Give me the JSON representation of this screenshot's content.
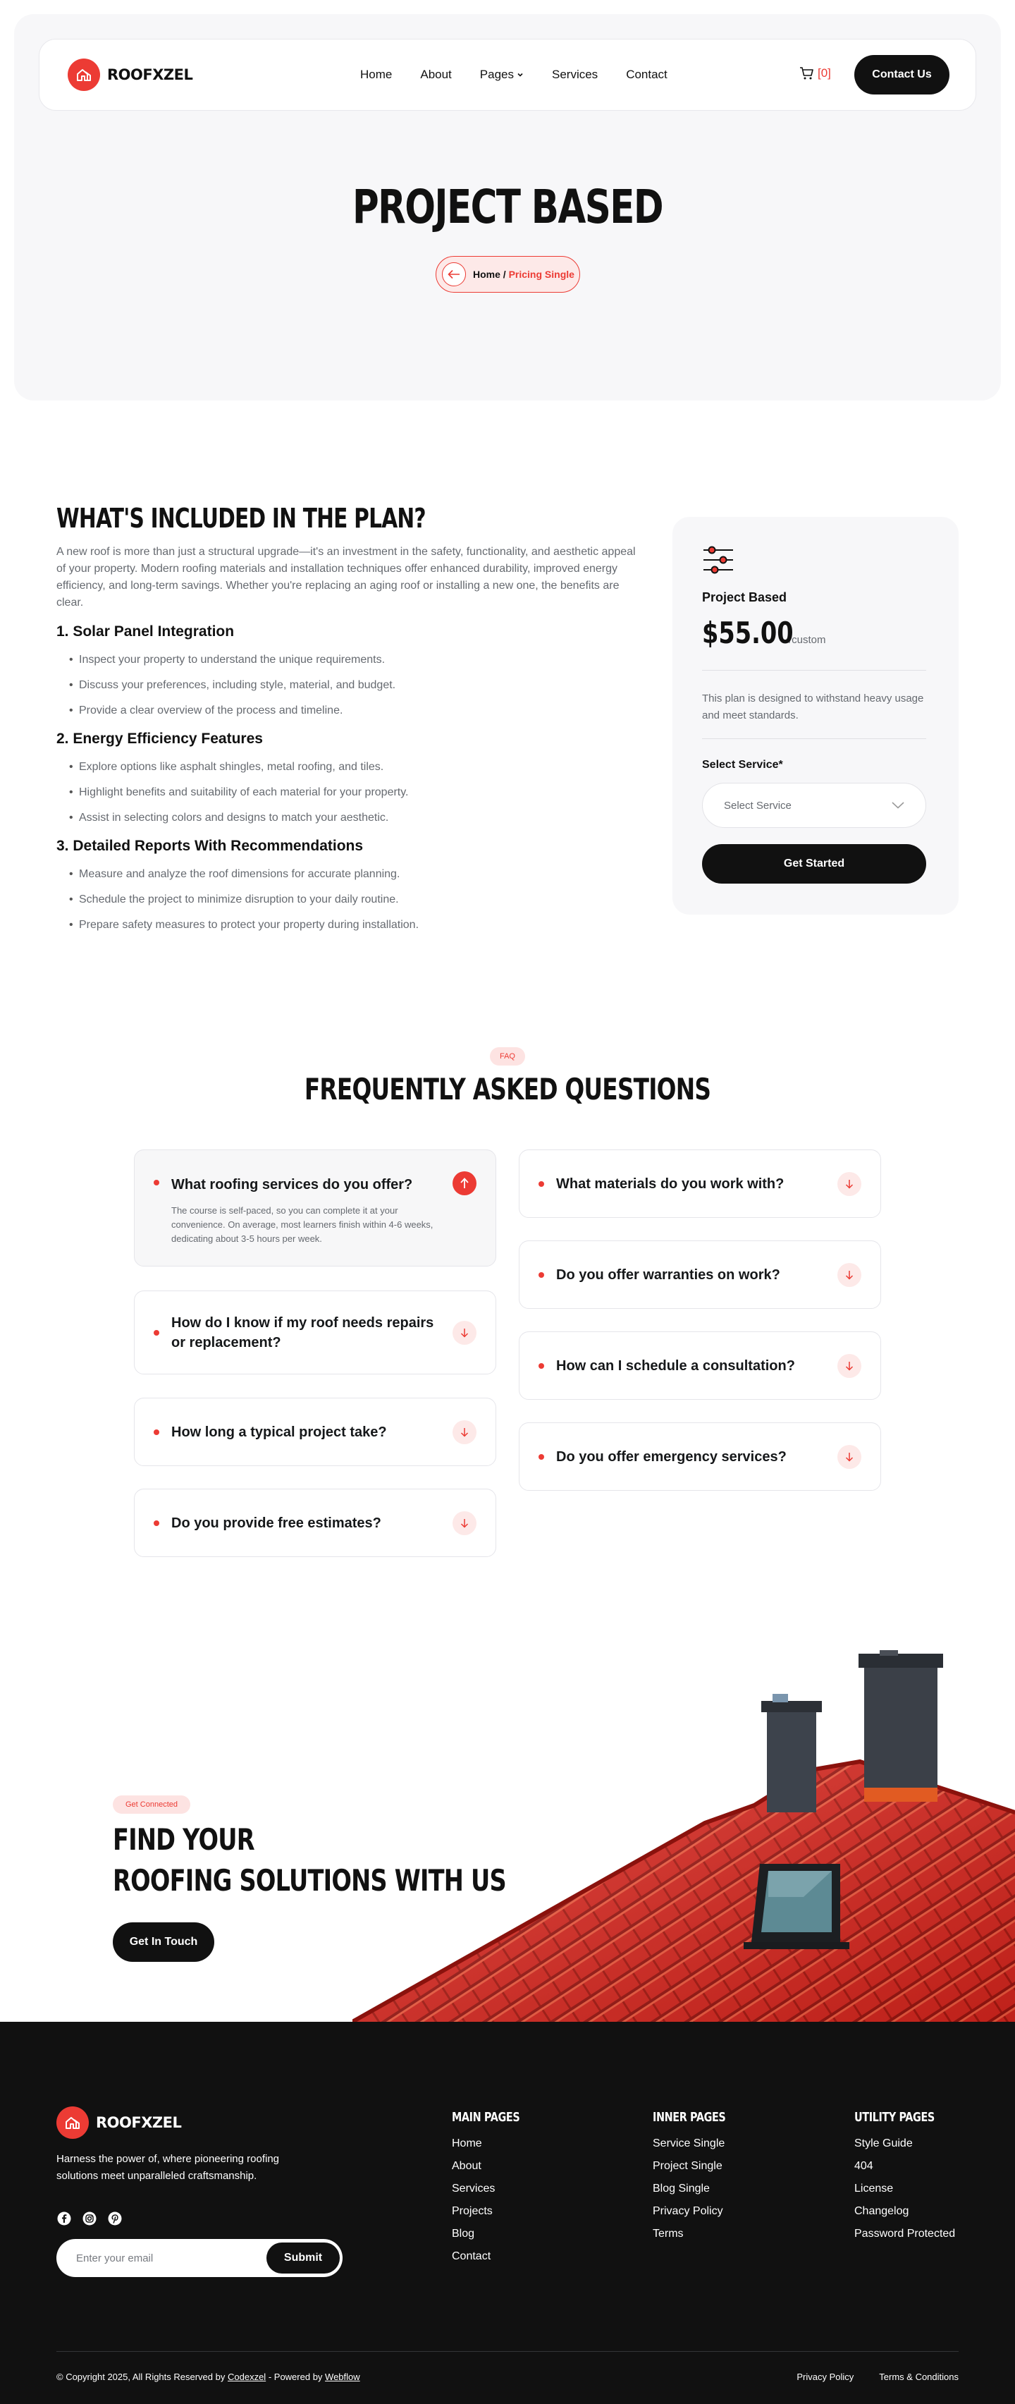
{
  "brand": {
    "name": "ROOFXZEL",
    "accent": "#ec3b34",
    "dark": "#111111"
  },
  "nav": {
    "links": [
      "Home",
      "About",
      "Pages",
      "Services",
      "Contact"
    ],
    "cart": "[0]",
    "cta": "Contact Us"
  },
  "hero": {
    "title": "PROJECT BASED",
    "breadcrumb_home": "Home",
    "breadcrumb_sep": "/",
    "breadcrumb_current": "Pricing Single"
  },
  "plan": {
    "title": "WHAT'S INCLUDED IN THE PLAN?",
    "intro": "A new roof is more than just a structural upgrade—it's an investment in the safety, functionality, and aesthetic appeal of your property. Modern roofing materials and installation techniques offer enhanced durability, improved energy efficiency, and long-term savings. Whether you're replacing an aging roof or installing a new one, the benefits are clear.",
    "sections": [
      {
        "heading": "1. Solar Panel Integration",
        "items": [
          "Inspect your property to understand the unique requirements.",
          "Discuss your preferences, including style, material, and budget.",
          "Provide a clear overview of the process and timeline."
        ]
      },
      {
        "heading": "2. Energy Efficiency Features",
        "items": [
          "Explore options like asphalt shingles, metal roofing, and tiles.",
          "Highlight benefits and suitability of each material for your property.",
          "Assist in selecting colors and designs to match your aesthetic."
        ]
      },
      {
        "heading": "3. Detailed Reports With Recommendations",
        "items": [
          "Measure and analyze the roof dimensions for accurate planning.",
          "Schedule the project to minimize disruption to your daily routine.",
          "Prepare safety measures to protect your property during installation."
        ]
      }
    ]
  },
  "pricing": {
    "name": "Project Based",
    "price": "$55.00",
    "unit": "/custom",
    "description": "This plan is designed to withstand heavy usage and meet standards.",
    "select_label": "Select Service*",
    "select_value": "Select Service",
    "cta": "Get Started"
  },
  "faq": {
    "tag": "FAQ",
    "title": "FREQUENTLY ASKED QUESTIONS",
    "open_question": "What roofing services do you offer?",
    "open_answer": "The course is self-paced, so you can complete it at your convenience. On average, most learners finish within 4-6 weeks, dedicating about 3-5 hours per week.",
    "left": [
      "How do I know if my roof needs repairs or replacement?",
      "How long a typical project take?",
      "Do you provide free estimates?"
    ],
    "right": [
      "What materials do you work with?",
      "Do you offer warranties on work?",
      "How can I schedule a consultation?",
      "Do you offer emergency services?"
    ]
  },
  "cta": {
    "tag": "Get Connected",
    "line1": "FIND YOUR",
    "line2": "ROOFING SOLUTIONS WITH US",
    "button": "Get In Touch"
  },
  "footer": {
    "about": "Harness the power of, where pioneering roofing solutions meet unparalleled craftsmanship.",
    "social_icons": [
      "facebook-icon",
      "instagram-icon",
      "pinterest-icon"
    ],
    "email_placeholder": "Enter your email",
    "submit": "Submit",
    "columns": [
      {
        "title": "MAIN PAGES",
        "links": [
          "Home",
          "About",
          "Services",
          "Projects",
          "Blog",
          "Contact"
        ]
      },
      {
        "title": "INNER PAGES",
        "links": [
          "Service Single",
          "Project Single",
          "Blog Single",
          "Privacy Policy",
          "Terms"
        ]
      },
      {
        "title": "UTILITY PAGES",
        "links": [
          "Style Guide",
          "404",
          "License",
          "Changelog",
          "Password Protected"
        ]
      }
    ],
    "copyright_prefix": "© Copyright 2025, All Rights Reserved by",
    "copyright_company": "Codexzel",
    "copyright_mid": "- Powered by",
    "copyright_platform": "Webflow",
    "legal": [
      "Privacy Policy",
      "Terms & Conditions"
    ]
  }
}
